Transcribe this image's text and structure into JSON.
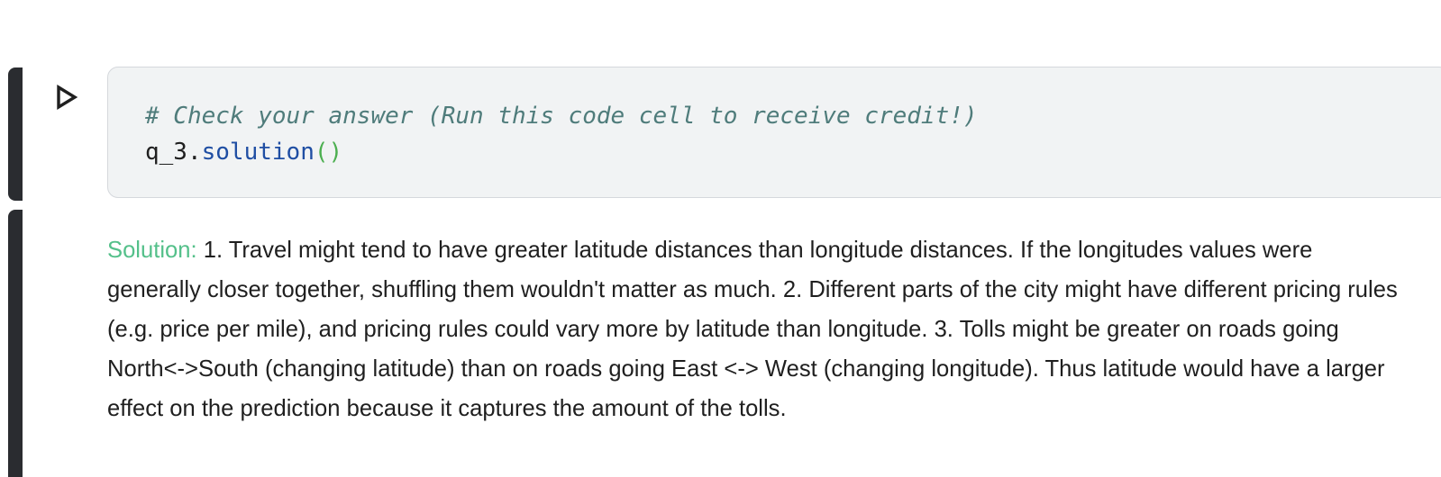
{
  "code_cell": {
    "run_icon": "play-triangle-outline-icon",
    "comment": "# Check your answer (Run this code cell to receive credit!)",
    "object": "q_3",
    "dot": ".",
    "method": "solution",
    "parens": "()"
  },
  "output": {
    "label": "Solution:",
    "text": "1. Travel might tend to have greater latitude distances than longitude distances. If the longitudes values were generally closer together, shuffling them wouldn't matter as much. 2. Different parts of the city might have different pricing rules (e.g. price per mile), and pricing rules could vary more by latitude than longitude. 3. Tolls might be greater on roads going North<->South (changing latitude) than on roads going East <-> West (changing longitude). Thus latitude would have a larger effect on the prediction because it captures the amount of the tolls."
  },
  "colors": {
    "cell_bar": "#2a2c30",
    "code_bg": "#f1f3f4",
    "comment": "#4f7c7b",
    "function": "#1f4ea3",
    "paren": "#4caf50",
    "solution_label": "#54c08a"
  }
}
